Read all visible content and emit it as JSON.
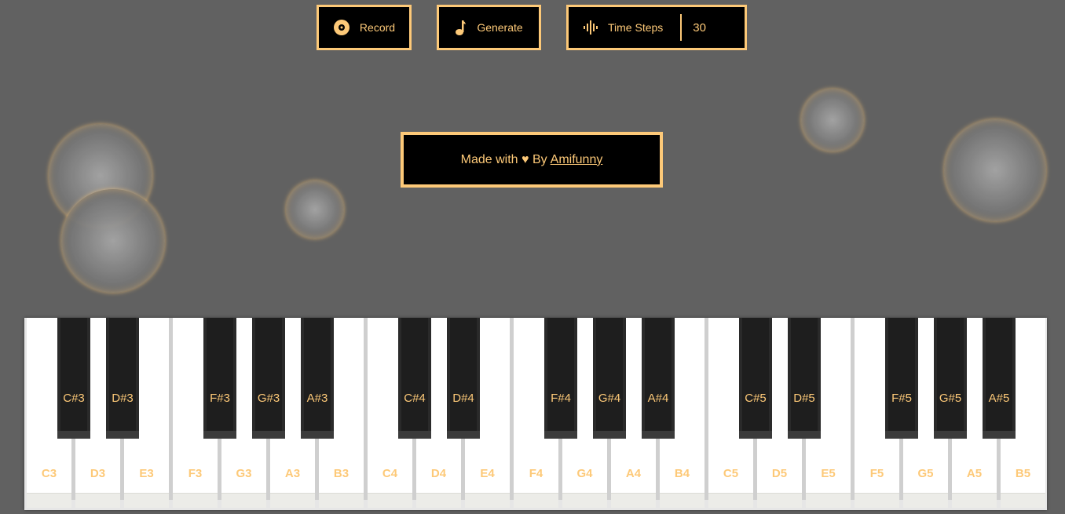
{
  "toolbar": {
    "record_label": "Record",
    "generate_label": "Generate",
    "time_steps_label": "Time Steps",
    "time_steps_value": "30"
  },
  "credit": {
    "prefix": "Made with ♥ By",
    "author_link": "Amifunny"
  },
  "colors": {
    "accent": "#fdc978",
    "background": "#616161",
    "button_bg": "#000000"
  },
  "piano": {
    "white_keys": [
      "C3",
      "D3",
      "E3",
      "F3",
      "G3",
      "A3",
      "B3",
      "C4",
      "D4",
      "E4",
      "F4",
      "G4",
      "A4",
      "B4",
      "C5",
      "D5",
      "E5",
      "F5",
      "G5",
      "A5",
      "B5"
    ],
    "black_keys": [
      "C#3",
      "D#3",
      "F#3",
      "G#3",
      "A#3",
      "C#4",
      "D#4",
      "F#4",
      "G#4",
      "A#4",
      "C#5",
      "D#5",
      "F#5",
      "G#5",
      "A#5"
    ]
  }
}
